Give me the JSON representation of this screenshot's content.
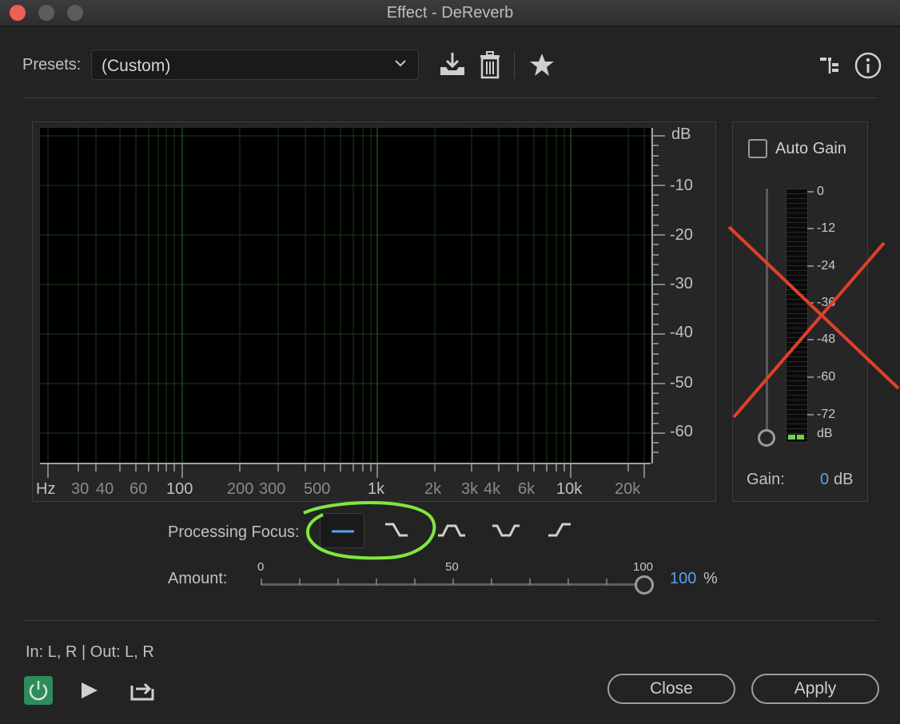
{
  "window": {
    "title": "Effect - DeReverb"
  },
  "presets": {
    "label": "Presets:",
    "value": "(Custom)"
  },
  "graph": {
    "db_labels": [
      "dB",
      "-10",
      "-20",
      "-30",
      "-40",
      "-50",
      "-60"
    ],
    "hz_labels": [
      "Hz",
      "30",
      "40",
      "60",
      "100",
      "200",
      "300",
      "500",
      "1k",
      "2k",
      "3k",
      "4k",
      "6k",
      "10k",
      "20k"
    ]
  },
  "gain_panel": {
    "auto_gain_label": "Auto Gain",
    "auto_gain_checked": false,
    "meter_labels": [
      "0",
      "-12",
      "-24",
      "-36",
      "-48",
      "-60",
      "-72",
      "dB"
    ],
    "gain_label": "Gain:",
    "gain_value": "0",
    "gain_unit": "dB"
  },
  "processing_focus": {
    "label": "Processing Focus:",
    "selected_index": 0
  },
  "amount": {
    "label": "Amount:",
    "scale": [
      "0",
      "50",
      "100"
    ],
    "value": "100",
    "unit": "%"
  },
  "io": {
    "text": "In: L, R | Out: L, R"
  },
  "buttons": {
    "close": "Close",
    "apply": "Apply"
  },
  "colors": {
    "accent_blue": "#5aa0ee",
    "power_green": "#2e8b5a",
    "annotation_red": "#e0402a",
    "annotation_green": "#7ee83c"
  }
}
